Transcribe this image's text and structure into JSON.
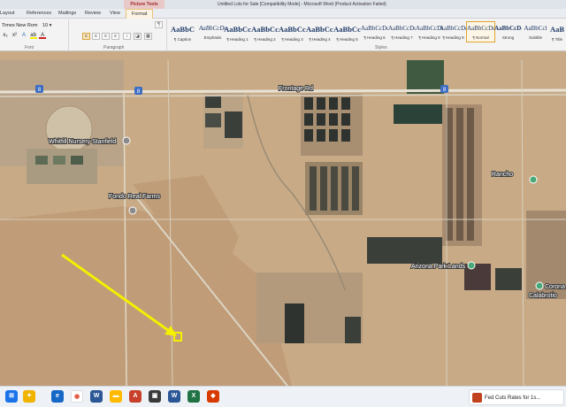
{
  "window": {
    "contextual_tab_group": "Picture Tools",
    "title": "Untitled Lots for Sale [Compatibility Mode] - Microsoft Word (Product Activation Failed)"
  },
  "ribbon": {
    "tabs": [
      "Layout",
      "References",
      "Mailings",
      "Review",
      "View",
      "Format"
    ],
    "active_tab": "Format",
    "font": {
      "name": "Times New Rom",
      "size": "10",
      "group_label": "Font"
    },
    "paragraph": {
      "group_label": "Paragraph"
    },
    "styles": {
      "group_label": "Styles",
      "items": [
        {
          "sample": "AaBbC",
          "name": "¶ Caption"
        },
        {
          "sample": "AaBbCcDc",
          "name": "Emphasis"
        },
        {
          "sample": "AaBbCc",
          "name": "¶ Heading 1"
        },
        {
          "sample": "AaBbCc",
          "name": "¶ Heading 2"
        },
        {
          "sample": "AaBbCcl",
          "name": "¶ Heading 3"
        },
        {
          "sample": "AaBbCcl",
          "name": "¶ Heading 4"
        },
        {
          "sample": "AaBbCc",
          "name": "¶ Heading 5"
        },
        {
          "sample": "AaBbCcDc",
          "name": "¶ Heading 6"
        },
        {
          "sample": "AaBbCcDc",
          "name": "¶ Heading 7"
        },
        {
          "sample": "AaBbCcDc",
          "name": "¶ Heading 8"
        },
        {
          "sample": "AaBbCcDc",
          "name": "¶ Heading 9"
        },
        {
          "sample": "AaBbCcDc",
          "name": "¶ Normal"
        },
        {
          "sample": "AaBbCcDd",
          "name": "Strong"
        },
        {
          "sample": "AaBbCcl",
          "name": "Subtitle"
        },
        {
          "sample": "AaB",
          "name": "¶ Title"
        }
      ],
      "selected": "¶ Normal"
    }
  },
  "map": {
    "labels": {
      "nursery": "Whitfill Nursery Stanfield",
      "farms": "Fondo Real Farms",
      "park": "Arizona Park Lands",
      "rancho": "Rancho",
      "corona": "Corona",
      "calabrotio": "Calabrotio",
      "interstate": "8",
      "frontage": "Frontage Rd"
    },
    "colors": {
      "desert": "#c8ab86",
      "field_dark": "#3b3f3a",
      "field_green": "#3f5a40",
      "road": "#e8e2d6",
      "arrow": "#f4f000",
      "pin": "#48a878"
    }
  },
  "taskbar": {
    "news_text": "Fed Cuts Rates for 1s..."
  }
}
